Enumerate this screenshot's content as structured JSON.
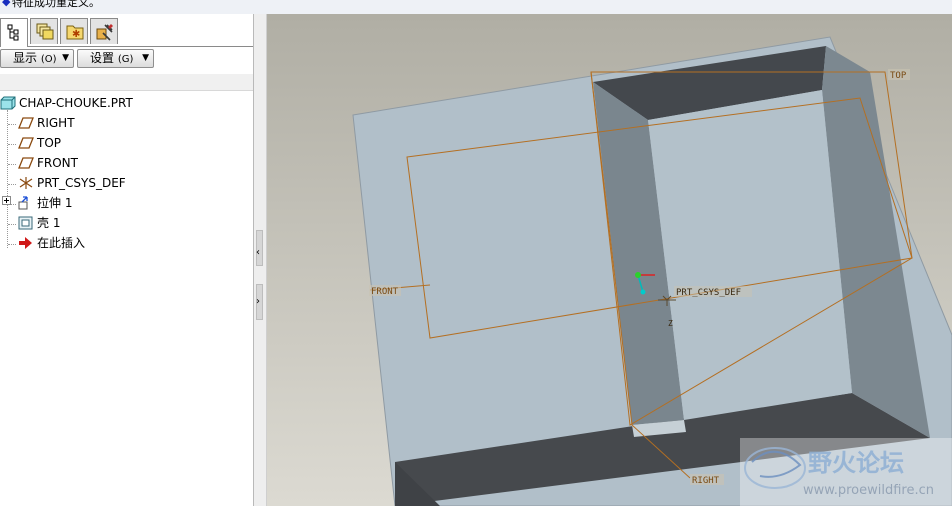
{
  "message_bar": {
    "text": "特征成功重定义。"
  },
  "tabs": [
    {
      "name": "model-tree",
      "icon": "model-tree-icon",
      "active": true
    },
    {
      "name": "layers",
      "icon": "layers-icon",
      "active": false
    },
    {
      "name": "favorites",
      "icon": "favorites-icon",
      "active": false
    },
    {
      "name": "tools",
      "icon": "tools-icon",
      "active": false
    }
  ],
  "toolbar": {
    "show_label": "显示",
    "show_hotkey": "(O)",
    "settings_label": "设置",
    "settings_hotkey": "(G)"
  },
  "tree": {
    "root": "CHAP-CHOUKE.PRT",
    "items": [
      "RIGHT",
      "TOP",
      "FRONT",
      "PRT_CSYS_DEF",
      "拉伸 1",
      "壳 1",
      "在此插入"
    ]
  },
  "viewport": {
    "labels": {
      "top": "TOP",
      "front": "FRONT",
      "right": "RIGHT",
      "csys": "PRT_CSYS_DEF",
      "z_axis": "Z"
    },
    "colors": {
      "background": "#c4c2b8",
      "part_face": "#b0bec8",
      "part_dark": "#474b50",
      "datum": "#c07a2a"
    }
  },
  "watermark": {
    "title": "野火论坛",
    "url": "www.proewildfire.cn"
  }
}
